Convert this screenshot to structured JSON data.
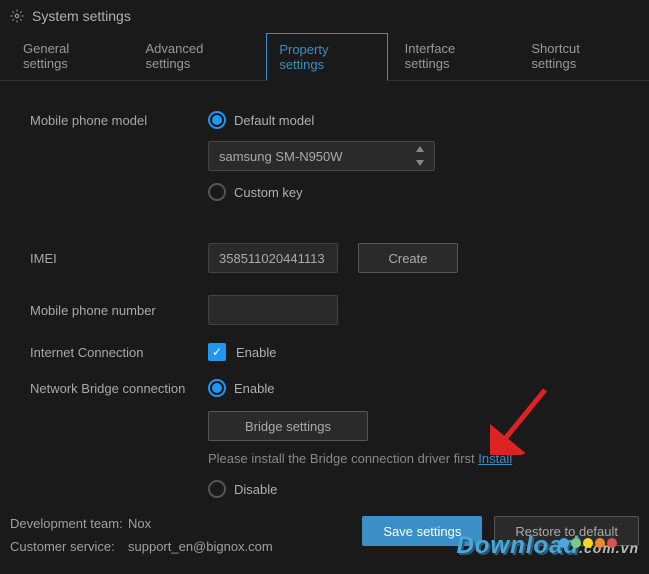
{
  "header": {
    "title": "System settings"
  },
  "tabs": {
    "items": [
      {
        "label": "General settings"
      },
      {
        "label": "Advanced settings"
      },
      {
        "label": "Property settings"
      },
      {
        "label": "Interface settings"
      },
      {
        "label": "Shortcut settings"
      }
    ],
    "active": 2
  },
  "fields": {
    "mobile_model": {
      "label": "Mobile phone model",
      "default_label": "Default model",
      "select_value": "samsung SM-N950W",
      "custom_label": "Custom key"
    },
    "imei": {
      "label": "IMEI",
      "value": "358511020441113",
      "create_label": "Create"
    },
    "phone_number": {
      "label": "Mobile phone number",
      "value": ""
    },
    "internet": {
      "label": "Internet Connection",
      "enable_label": "Enable"
    },
    "bridge": {
      "label": "Network Bridge connection",
      "enable_label": "Enable",
      "settings_label": "Bridge settings",
      "hint_text": "Please install the Bridge connection driver first ",
      "install_label": "Install",
      "disable_label": "Disable"
    }
  },
  "footer": {
    "dev_label": "Development team:",
    "dev_value": "Nox",
    "support_label": "Customer service:",
    "support_value": "support_en@bignox.com",
    "save_label": "Save settings",
    "restore_label": "Restore to default"
  },
  "watermark": {
    "text": "Download",
    "sub": ".com.vn"
  }
}
